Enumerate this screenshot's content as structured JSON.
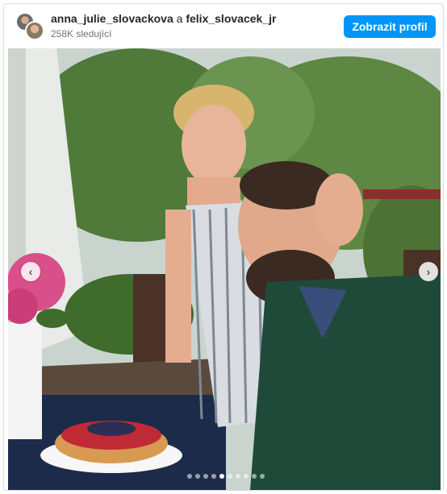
{
  "header": {
    "user1": "anna_julie_slovackova",
    "joiner": "a",
    "user2": "felix_slovacek_jr",
    "followers": "258K sledující",
    "profile_button": "Zobrazit profil"
  },
  "icons": {
    "prev": "chevron-left-icon",
    "next": "chevron-right-icon"
  },
  "carousel": {
    "total_slides": 10,
    "active_slide": 5
  },
  "colors": {
    "accent": "#0095f6",
    "muted": "#737373"
  }
}
